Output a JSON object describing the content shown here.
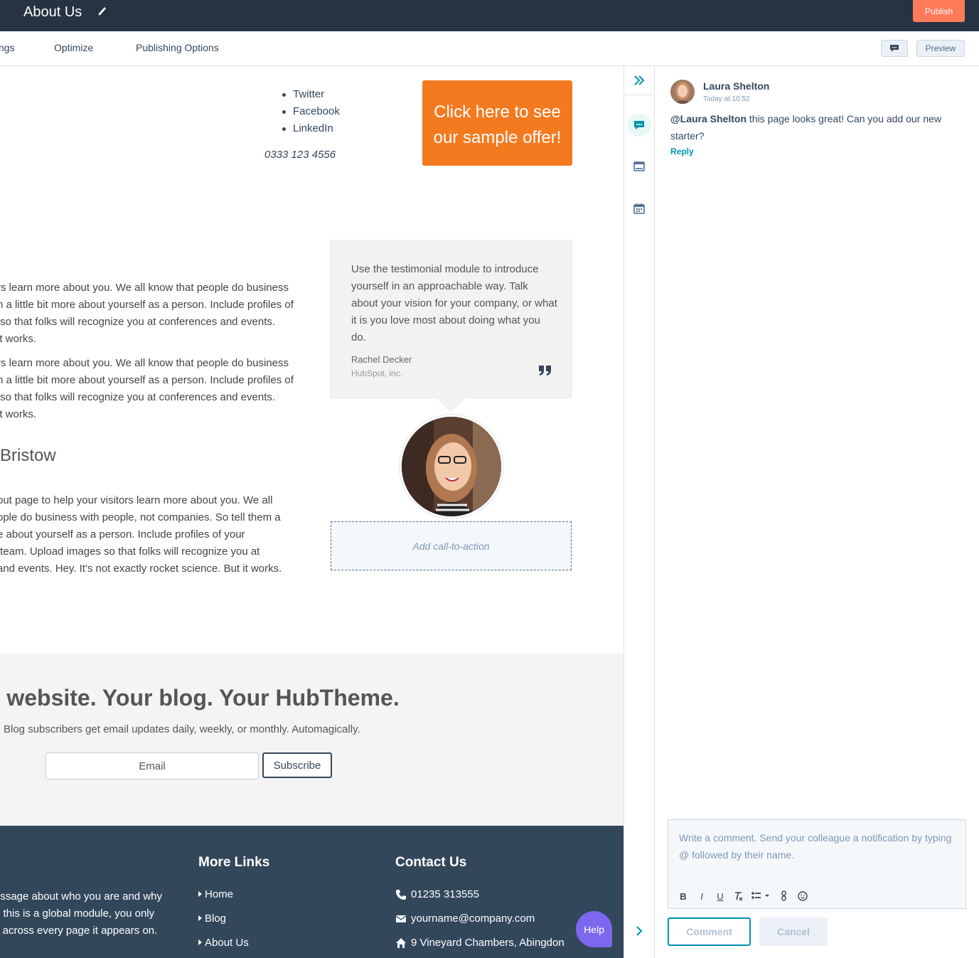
{
  "header": {
    "page_title": "About Us",
    "publish_label": "Publish"
  },
  "tabs": [
    "ngs",
    "Optimize",
    "Publishing Options"
  ],
  "toolbar": {
    "preview_label": "Preview"
  },
  "canvas": {
    "social_links": [
      "Twitter",
      "Facebook",
      "LinkedIn"
    ],
    "phone": "0333 123 4556",
    "offer_cta": "Click here to see our sample offer!",
    "paragraph_1": "rs learn more about you. We all know that people do business\nn a little bit more about yourself as a person. Include profiles of\n so that folks will recognize you at conferences and events.\nit works.",
    "paragraph_2": "rs learn more about you. We all know that people do business\nn a little bit more about yourself as a person. Include profiles of\n so that folks will recognize you at conferences and events.\nit works.",
    "section_heading": "Bristow",
    "paragraph_3": "out page to help your visitors learn more about you. We all\nople do business with people, not companies. So tell them a\ne about yourself as a person. Include profiles of your\n team. Upload images so that folks will recognize you at\nand events. Hey. It's not exactly rocket science. But it works.",
    "testimonial": {
      "quote": "Use the testimonial module to introduce yourself in an approachable way. Talk about your vision for your company, or what it is you love most about doing what you do.",
      "author": "Rachel Decker",
      "company": "HubSpot, inc."
    },
    "add_cta_label": "Add call-to-action",
    "subscribe": {
      "heading": "r website. Your blog. Your HubTheme.",
      "text": "Blog subscribers get email updates daily, weekly, or monthly. Automagically.",
      "email_placeholder": "Email",
      "button_label": "Subscribe"
    },
    "footer": {
      "about_text": "essage about who you are and why\ne this is a global module, you only\ns across every page it appears on.",
      "links_heading": "More Links",
      "links": [
        "Home",
        "Blog",
        "About Us"
      ],
      "contact_heading": "Contact Us",
      "contact": [
        {
          "icon": "phone-icon",
          "text": "01235 313555"
        },
        {
          "icon": "envelope-icon",
          "text": "yourname@company.com"
        },
        {
          "icon": "home-icon",
          "text": "9 Vineyard Chambers, Abingdon"
        }
      ]
    },
    "help_label": "Help"
  },
  "comments": {
    "author": "Laura Shelton",
    "time": "Today at 10:52",
    "mention": "@Laura Shelton",
    "body": " this page looks great! Can you add our new starter?",
    "reply_label": "Reply",
    "editor_placeholder": "Write a comment. Send your colleague a notification by typing @ followed by their name.",
    "comment_label": "Comment",
    "cancel_label": "Cancel"
  },
  "colors": {
    "topbar": "#253342",
    "publish": "#ff7a59",
    "offer": "#f47a20",
    "accent": "#0091ae",
    "footer": "#33475b",
    "help": "#7b68ee"
  }
}
